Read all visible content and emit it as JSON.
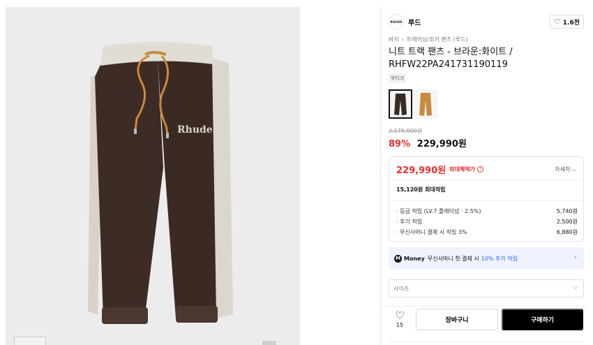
{
  "product_image": {
    "brand_print": "Rhude",
    "colors": {
      "body": "#3b2a24",
      "band": "#e2ddd4",
      "cord": "#c98a3d"
    }
  },
  "brand": {
    "logo_text": "RHUDE",
    "name": "루드",
    "like_count": "1.6천"
  },
  "breadcrumb": [
    "바지",
    "트레이닝/조거 팬츠 (루드)"
  ],
  "title": "니트 트랙 팬츠 - 브라운:화이트 / RHFW22PA241731190119",
  "tag": "부티크",
  "options": [
    {
      "name": "브라운",
      "color": "#3b2a24",
      "selected": true
    },
    {
      "name": "브라운 오렌지",
      "color": "#c98a3d",
      "selected": false
    }
  ],
  "price": {
    "original": "2,175,000원",
    "discount_rate": "89%",
    "sale": "229,990원"
  },
  "benefits": {
    "max_price": "229,990원",
    "max_label": "최대혜택가",
    "detail_label": "자세히",
    "max_points": "15,120원 최대적립",
    "items": [
      {
        "label": "· 등급 적립 (LV.7 플래티넘 · 2.5%)",
        "value": "5,740원"
      },
      {
        "label": "· 후기 적립",
        "value": "2,500원"
      },
      {
        "label": "· 무신사머니 결제 시 적립 3%",
        "value": "6,880원"
      }
    ]
  },
  "money_banner": {
    "brand": "Money",
    "text_before": "무신사머니 첫 결제 시",
    "highlight": "10% 추가 적립"
  },
  "size_select": {
    "placeholder": "사이즈"
  },
  "actions": {
    "wish_count": "15",
    "cart_label": "장바구니",
    "buy_label": "구매하기"
  },
  "accent_colors": {
    "sale_red": "#e6312b",
    "link_blue": "#2a6be8",
    "buy_bg": "#000000"
  }
}
